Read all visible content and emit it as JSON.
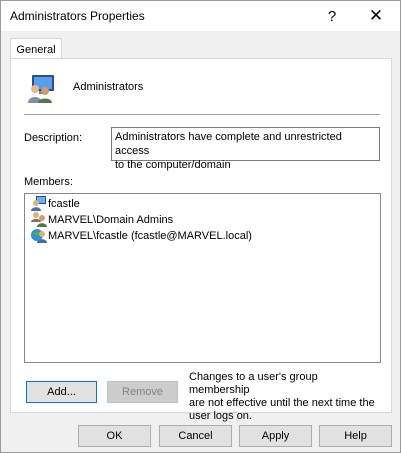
{
  "window": {
    "title": "Administrators Properties",
    "help_glyph": "?",
    "close_glyph": "✕"
  },
  "tabs": [
    {
      "label": "General",
      "selected": true
    }
  ],
  "general": {
    "group_name": "Administrators",
    "description_label": "Description:",
    "description_line1": "Administrators have complete and unrestricted access",
    "description_line2": "to the computer/domain",
    "members_label": "Members:",
    "members": [
      {
        "name": "fcastle",
        "icon": "local-user-icon"
      },
      {
        "name": "MARVEL\\Domain Admins",
        "icon": "domain-group-icon"
      },
      {
        "name": "MARVEL\\fcastle (fcastle@MARVEL.local)",
        "icon": "domain-user-icon"
      }
    ],
    "add_label": "Add...",
    "remove_label": "Remove",
    "note_line1": "Changes to a user's group membership",
    "note_line2": "are not effective until the next time the",
    "note_line3": "user logs on."
  },
  "footer": {
    "ok_label": "OK",
    "cancel_label": "Cancel",
    "apply_label": "Apply",
    "help_label": "Help"
  },
  "colors": {
    "accent": "#0078d7",
    "window_bg": "#f0f0f0",
    "panel_bg": "#ffffff"
  }
}
